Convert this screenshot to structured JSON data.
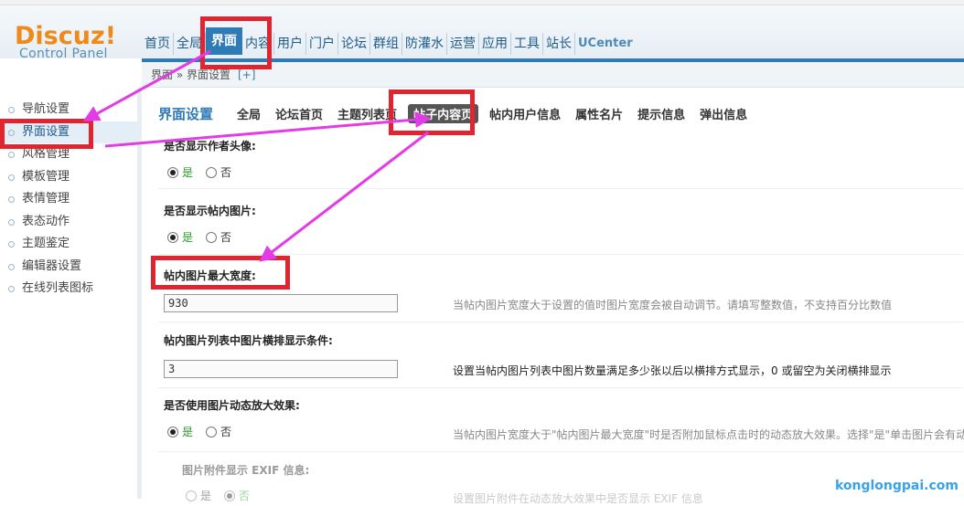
{
  "logo": {
    "brand": "Discuz",
    "bang": "!",
    "sub": "Control Panel"
  },
  "nav": [
    "首页",
    "全局",
    "界面",
    "内容",
    "用户",
    "门户",
    "论坛",
    "群组",
    "防灌水",
    "运营",
    "应用",
    "工具",
    "站长",
    "UCenter"
  ],
  "nav_active": 2,
  "breadcrumb": {
    "path": "界面 » 界面设置",
    "plus": "[+]"
  },
  "sidebar": [
    "导航设置",
    "界面设置",
    "风格管理",
    "模板管理",
    "表情管理",
    "表态动作",
    "主题鉴定",
    "编辑器设置",
    "在线列表图标"
  ],
  "sidebar_active": 1,
  "tabs": {
    "title": "界面设置",
    "items": [
      "全局",
      "论坛首页",
      "主题列表页",
      "帖子内容页",
      "帖内用户信息",
      "属性名片",
      "提示信息",
      "弹出信息"
    ],
    "active": 3
  },
  "settings": {
    "avatar": {
      "label": "是否显示作者头像:",
      "yes": "是",
      "no": "否"
    },
    "images": {
      "label": "是否显示帖内图片:",
      "yes": "是",
      "no": "否"
    },
    "maxwidth": {
      "label": "帖内图片最大宽度:",
      "value": "930",
      "hint": "当帖内图片宽度大于设置的值时图片宽度会被自动调节。请填写整数值，不支持百分比数值"
    },
    "listcond": {
      "label": "帖内图片列表中图片横排显示条件:",
      "value": "3",
      "hint": "设置当帖内图片列表中图片数量满足多少张以后以横排方式显示，0 或留空为关闭横排显示"
    },
    "zoom": {
      "label": "是否使用图片动态放大效果:",
      "yes": "是",
      "no": "否",
      "hint": "当帖内图片宽度大于\"帖内图片最大宽度\"时是否附加鼠标点击时的动态放大效果。选择\"是\"单击图片会有动"
    },
    "exif": {
      "label": "图片附件显示 EXIF 信息:",
      "yes": "是",
      "no": "否",
      "hint": "设置图片附件在动态放大效果中是否显示 EXIF 信息"
    }
  },
  "watermark": "konglongpai.com",
  "colors": {
    "accent": "#2f7bb5",
    "annotation": "#e02530",
    "arrow": "#e23ce6",
    "logo": "#ee8a18"
  }
}
